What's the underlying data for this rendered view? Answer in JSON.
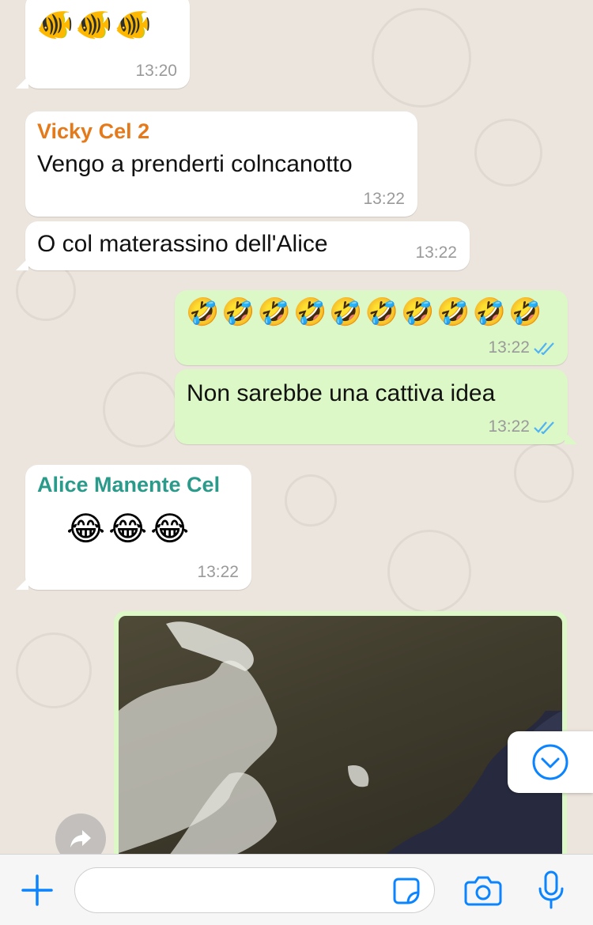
{
  "colors": {
    "accent": "#0A84FF",
    "incoming_bubble": "#FFFFFF",
    "outgoing_bubble": "#DCF8C6",
    "sender_vicky": "#E47A1A",
    "sender_alice": "#2A9A8A",
    "read_ticks": "#4FB3F6"
  },
  "messages": [
    {
      "direction": "in",
      "emojis": "🐠🐠🐠",
      "time": "13:20"
    },
    {
      "direction": "in",
      "sender": "Vicky Cel 2",
      "text": "Vengo a prenderti colncanotto",
      "time": "13:22"
    },
    {
      "direction": "in",
      "text": "O col materassino dell'Alice",
      "time": "13:22"
    },
    {
      "direction": "out",
      "emojis": "🤣🤣🤣🤣🤣🤣🤣🤣🤣🤣",
      "time": "13:22",
      "status": "read"
    },
    {
      "direction": "out",
      "text": "Non sarebbe una cattiva idea",
      "time": "13:22",
      "status": "read"
    },
    {
      "direction": "in",
      "sender": "Alice Manente Cel",
      "emojis": "😂😂😂",
      "time": "13:22"
    },
    {
      "direction": "out",
      "type": "image"
    }
  ],
  "input": {
    "placeholder": "",
    "value": "",
    "icons": [
      "plus-icon",
      "sticker-icon",
      "camera-icon",
      "microphone-icon"
    ]
  },
  "overlays": {
    "scroll_down_icon": "chevron-down-circle-icon",
    "forward_icon": "forward-arrow-icon"
  }
}
